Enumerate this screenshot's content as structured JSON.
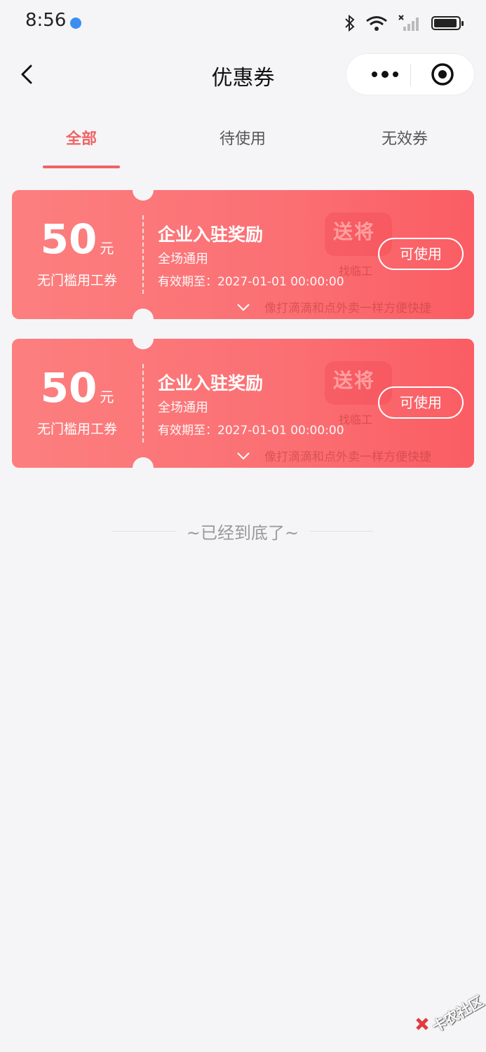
{
  "status_bar": {
    "time": "8:56"
  },
  "nav": {
    "title": "优惠券"
  },
  "tabs": [
    {
      "label": "全部",
      "active": true
    },
    {
      "label": "待使用",
      "active": false
    },
    {
      "label": "无效券",
      "active": false
    }
  ],
  "coupons": [
    {
      "amount": "50",
      "unit": "元",
      "desc": "无门槛用工券",
      "title": "企业入驻奖励",
      "scope": "全场通用",
      "valid": "有效期至：2027-01-01 00:00:00",
      "more": "像打滴滴和点外卖一样方便快捷",
      "button": "可使用",
      "watermark_main": "送将",
      "watermark_sub": "找临工"
    },
    {
      "amount": "50",
      "unit": "元",
      "desc": "无门槛用工券",
      "title": "企业入驻奖励",
      "scope": "全场通用",
      "valid": "有效期至：2027-01-01 00:00:00",
      "more": "像打滴滴和点外卖一样方便快捷",
      "button": "可使用",
      "watermark_main": "送将",
      "watermark_sub": "找临工"
    }
  ],
  "footer": {
    "end_text": "~已经到底了~"
  },
  "corner_watermark": "卡农社区",
  "colors": {
    "accent": "#f06464",
    "coupon": "#fb6f73",
    "background": "#f5f5f7"
  }
}
